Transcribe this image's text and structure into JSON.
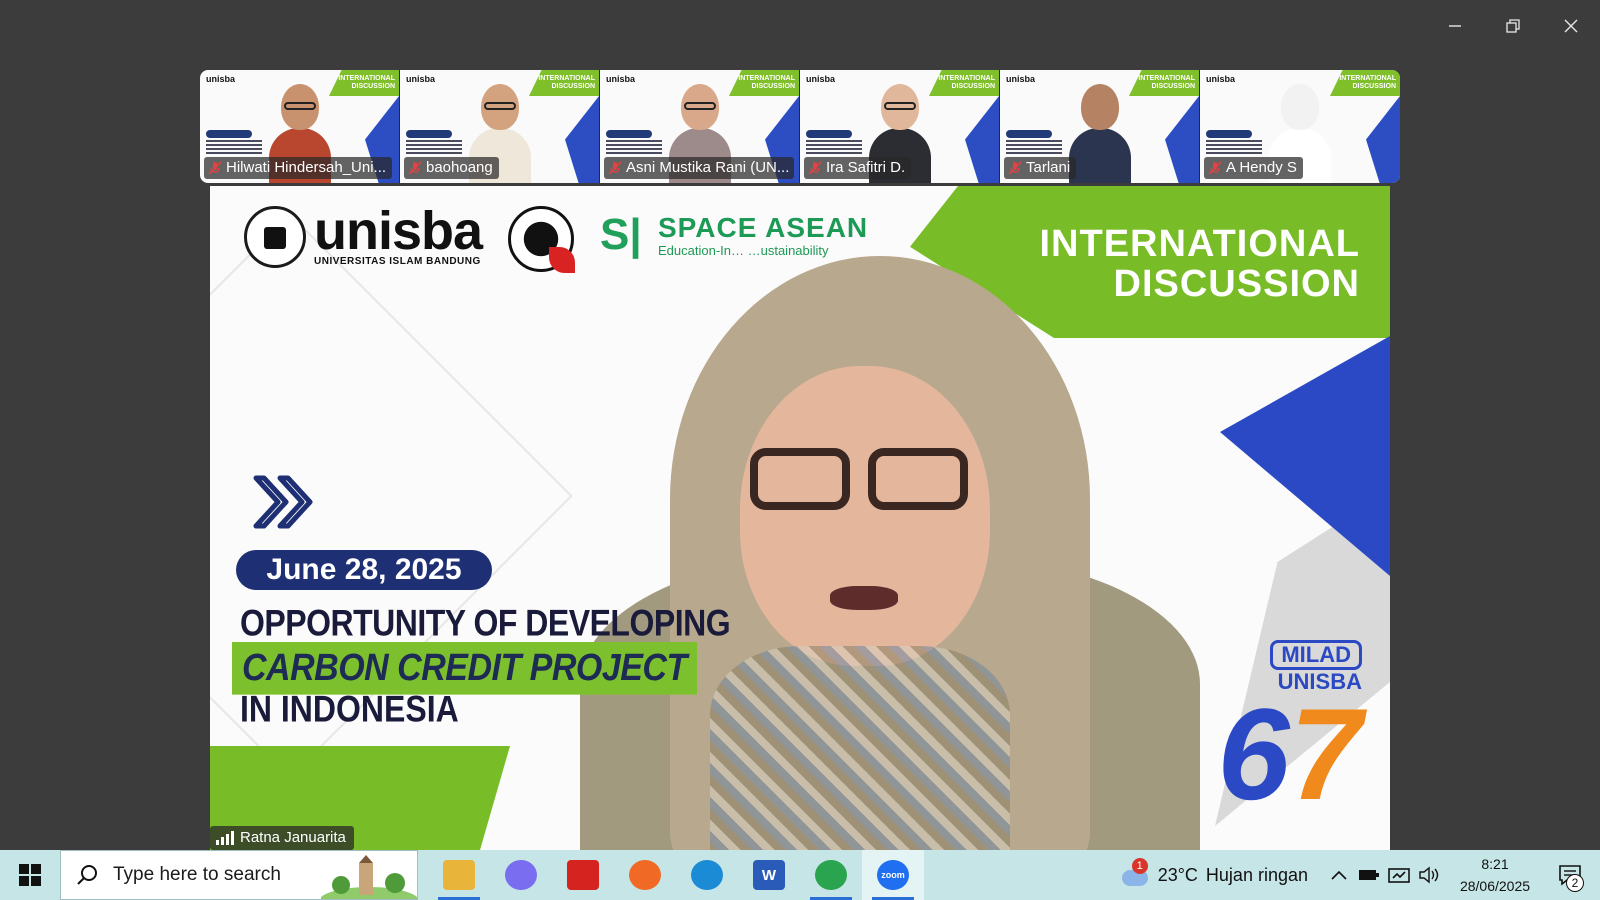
{
  "window": {
    "controls": [
      "minimize-icon",
      "restore-icon",
      "close-icon"
    ]
  },
  "participants": [
    {
      "name": "Hilwati Hindersah_Uni...",
      "skin": "#c8926f",
      "wear": "#b9472f",
      "glasses": true
    },
    {
      "name": "baohoang",
      "skin": "#d3a27e",
      "wear": "#efe7da",
      "glasses": true
    },
    {
      "name": "Asni Mustika Rani (UN...",
      "skin": "#d9a88a",
      "wear": "#9d8a8a",
      "glasses": true
    },
    {
      "name": "Ira Safitri D.",
      "skin": "#e1b79c",
      "wear": "#2c2c33",
      "glasses": true
    },
    {
      "name": "Tarlani",
      "skin": "#b58263",
      "wear": "#2b3550",
      "glasses": false
    },
    {
      "name": "A Hendy S",
      "skin": "#f2f2f2",
      "wear": "#ffffff",
      "glasses": false
    }
  ],
  "tile_banner": {
    "logo": "unisba",
    "intl": "INTERNATIONAL DISCUSSION"
  },
  "main": {
    "speaker_name": "Ratna Januarita",
    "unisba": "unisba",
    "unisba_sub": "UNIVERSITAS ISLAM BANDUNG",
    "space_title": "SPACE ASEAN",
    "space_tagline": "Education-In… …ustainability",
    "intl_line1": "INTERNATIONAL",
    "intl_line2": "DISCUSSION",
    "date": "June 28, 2025",
    "topic_line1": "OPPORTUNITY OF DEVELOPING",
    "topic_line2": "CARBON CREDIT PROJECT",
    "topic_line3": "IN INDONESIA",
    "milad_line1": "MILAD",
    "milad_line2": "UNISBA",
    "milad_num_a": "6",
    "milad_num_b": "7"
  },
  "taskbar": {
    "search_placeholder": "Type here to search",
    "apps": [
      {
        "name": "file-explorer",
        "color": "#e8b43a",
        "label": "",
        "active": true
      },
      {
        "name": "copilot",
        "color": "#7a6df0",
        "label": "",
        "active": false
      },
      {
        "name": "acrobat",
        "color": "#d5231f",
        "label": "",
        "active": false
      },
      {
        "name": "firefox",
        "color": "#f06a25",
        "label": "",
        "active": false
      },
      {
        "name": "edge",
        "color": "#1c8bd6",
        "label": "",
        "active": false
      },
      {
        "name": "word",
        "color": "#2b5bb8",
        "label": "W",
        "active": false
      },
      {
        "name": "chrome",
        "color": "#2aa44f",
        "label": "",
        "active": true
      },
      {
        "name": "zoom",
        "color": "#1f6ff0",
        "label": "zoom",
        "active": true
      }
    ],
    "weather_badge": "1",
    "weather_temp": "23°C",
    "weather_desc": "Hujan ringan",
    "time": "8:21",
    "date": "28/06/2025",
    "notification_count": "2"
  }
}
